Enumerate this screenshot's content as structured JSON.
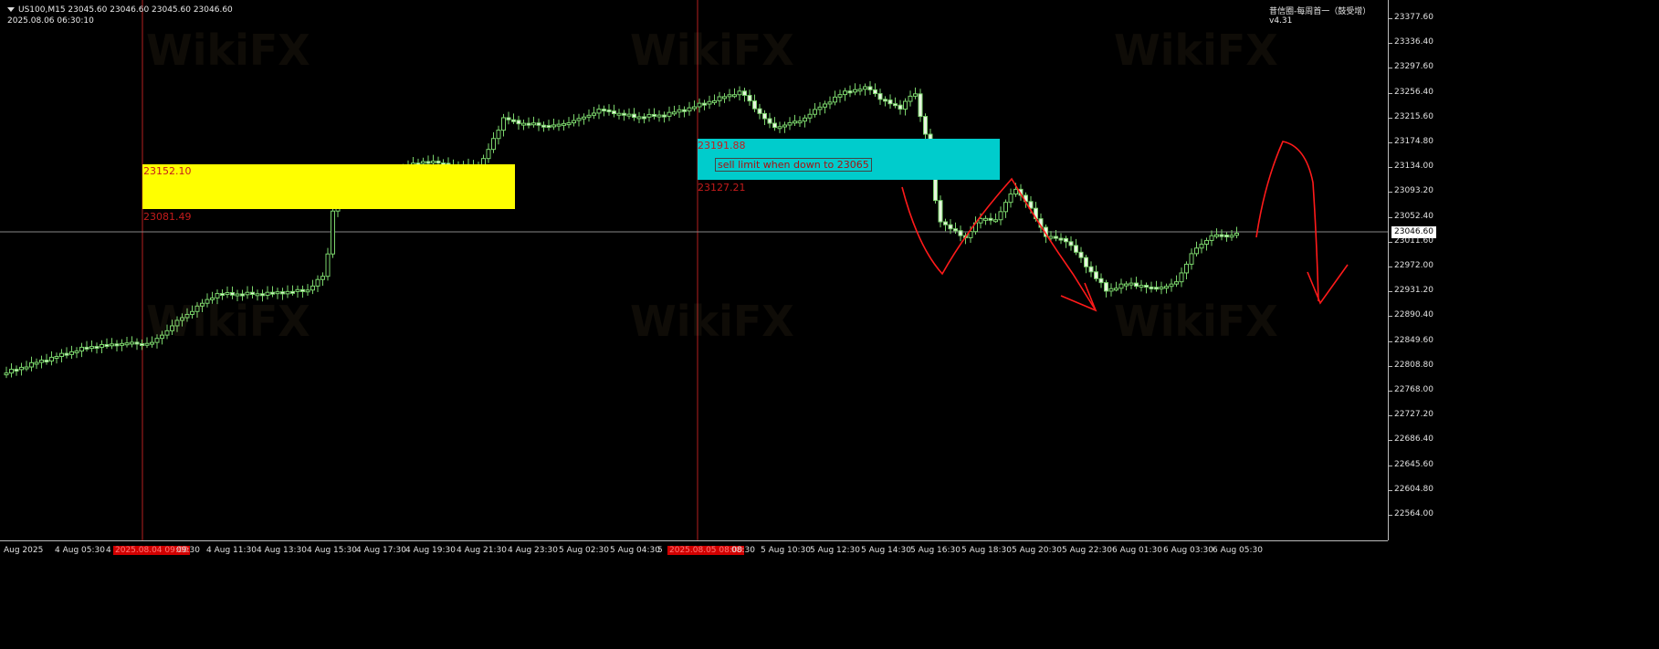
{
  "chart_info": {
    "line1": "US100,M15  23045.60 23046.60 23045.60 23046.60",
    "line2": "2025.08.06 06:30:10"
  },
  "indicator_label": "昔信圈-每周首一（鼓受增） v4.31",
  "current_price": "23046.60",
  "price_axis": [
    "23377.60",
    "23336.40",
    "23297.60",
    "23256.40",
    "23215.60",
    "23174.80",
    "23134.00",
    "23093.20",
    "23052.40",
    "23011.60",
    "22972.00",
    "22931.20",
    "22890.40",
    "22849.60",
    "22808.80",
    "22768.00",
    "22727.20",
    "22686.40",
    "22645.60",
    "22604.80",
    "22564.00"
  ],
  "time_axis": [
    {
      "label": "Aug 2025",
      "hl": false
    },
    {
      "label": "4 Aug 05:30",
      "hl": false
    },
    {
      "label": "4",
      "hl": false
    },
    {
      "label": "2025.08.04 09:00",
      "hl": true
    },
    {
      "label": "09:30",
      "hl": false
    },
    {
      "label": "4 Aug 11:30",
      "hl": false
    },
    {
      "label": "4 Aug 13:30",
      "hl": false
    },
    {
      "label": "4 Aug 15:30",
      "hl": false
    },
    {
      "label": "4 Aug 17:30",
      "hl": false
    },
    {
      "label": "4 Aug 19:30",
      "hl": false
    },
    {
      "label": "4 Aug 21:30",
      "hl": false
    },
    {
      "label": "4 Aug 23:30",
      "hl": false
    },
    {
      "label": "5 Aug 02:30",
      "hl": false
    },
    {
      "label": "5 Aug 04:30",
      "hl": false
    },
    {
      "label": "5",
      "hl": false
    },
    {
      "label": "2025.08.05 08:00",
      "hl": true
    },
    {
      "label": "08:30",
      "hl": false
    },
    {
      "label": "5 Aug 10:30",
      "hl": false
    },
    {
      "label": "5 Aug 12:30",
      "hl": false
    },
    {
      "label": "5 Aug 14:30",
      "hl": false
    },
    {
      "label": "5 Aug 16:30",
      "hl": false
    },
    {
      "label": "5 Aug 18:30",
      "hl": false
    },
    {
      "label": "5 Aug 20:30",
      "hl": false
    },
    {
      "label": "5 Aug 22:30",
      "hl": false
    },
    {
      "label": "6 Aug 01:30",
      "hl": false
    },
    {
      "label": "6 Aug 03:30",
      "hl": false
    },
    {
      "label": "6 Aug 05:30",
      "hl": false
    }
  ],
  "zones": {
    "yellow": {
      "top_label": "23152.10",
      "bottom_label": "23081.49",
      "color": "#ffff00"
    },
    "cyan": {
      "top_label": "23191.88",
      "bottom_label": "23127.21",
      "color": "#00c8c8"
    }
  },
  "note": "sell limit when down to 23065",
  "watermark": "WikiFX",
  "colors": {
    "candle": "#7ad36b",
    "hline": "#888888",
    "vline": "#b32020",
    "annotation": "#ff1a1a"
  }
}
